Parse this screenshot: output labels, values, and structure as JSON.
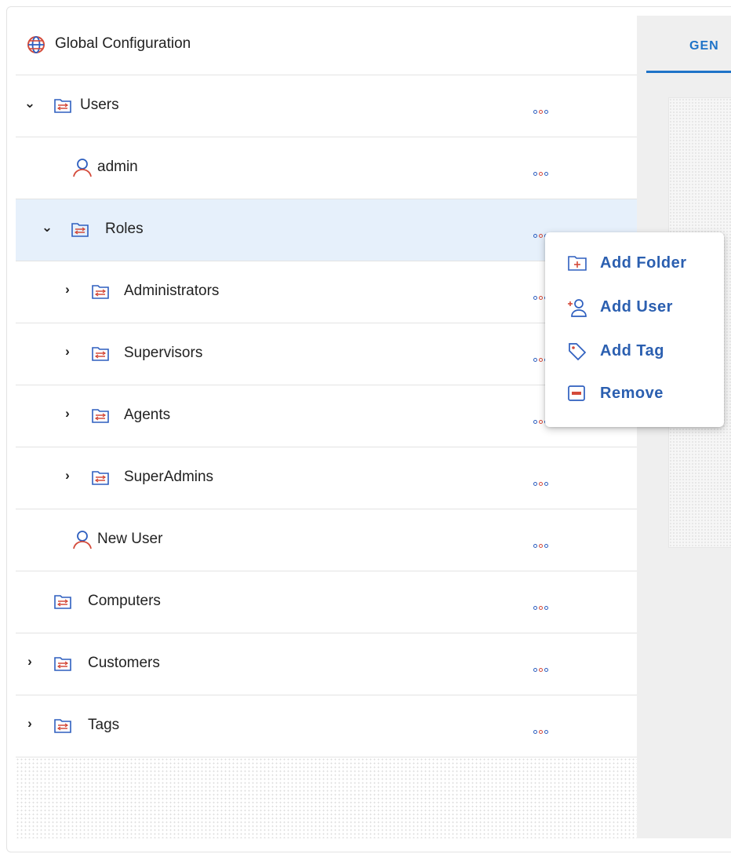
{
  "tab": {
    "label": "GEN"
  },
  "tree": {
    "header": {
      "title": "Global Configuration",
      "icon": "globe-icon"
    },
    "rows": [
      {
        "label": "Users",
        "type": "folder",
        "expander": "expanded"
      },
      {
        "label": "admin",
        "type": "user",
        "expander": "none"
      },
      {
        "label": "Roles",
        "type": "folder",
        "expander": "expanded",
        "selected": true
      },
      {
        "label": "Administrators",
        "type": "folder",
        "expander": "collapsed"
      },
      {
        "label": "Supervisors",
        "type": "folder",
        "expander": "collapsed"
      },
      {
        "label": "Agents",
        "type": "folder",
        "expander": "collapsed"
      },
      {
        "label": "SuperAdmins",
        "type": "folder",
        "expander": "collapsed"
      },
      {
        "label": "New User",
        "type": "user",
        "expander": "none"
      },
      {
        "label": "Computers",
        "type": "folder",
        "expander": "none"
      },
      {
        "label": "Customers",
        "type": "folder",
        "expander": "collapsed"
      },
      {
        "label": "Tags",
        "type": "folder",
        "expander": "collapsed"
      }
    ]
  },
  "context_menu": {
    "items": [
      {
        "label": "Add Folder",
        "icon": "add-folder-icon"
      },
      {
        "label": "Add User",
        "icon": "add-user-icon"
      },
      {
        "label": "Add Tag",
        "icon": "tag-icon"
      },
      {
        "label": "Remove",
        "icon": "remove-icon"
      }
    ]
  },
  "colors": {
    "accent": "#1e73c8",
    "menu_text": "#2b5fb0",
    "selected_row": "#e6f0fb",
    "icon_blue": "#2e5fbf",
    "icon_red": "#d44a3a"
  }
}
